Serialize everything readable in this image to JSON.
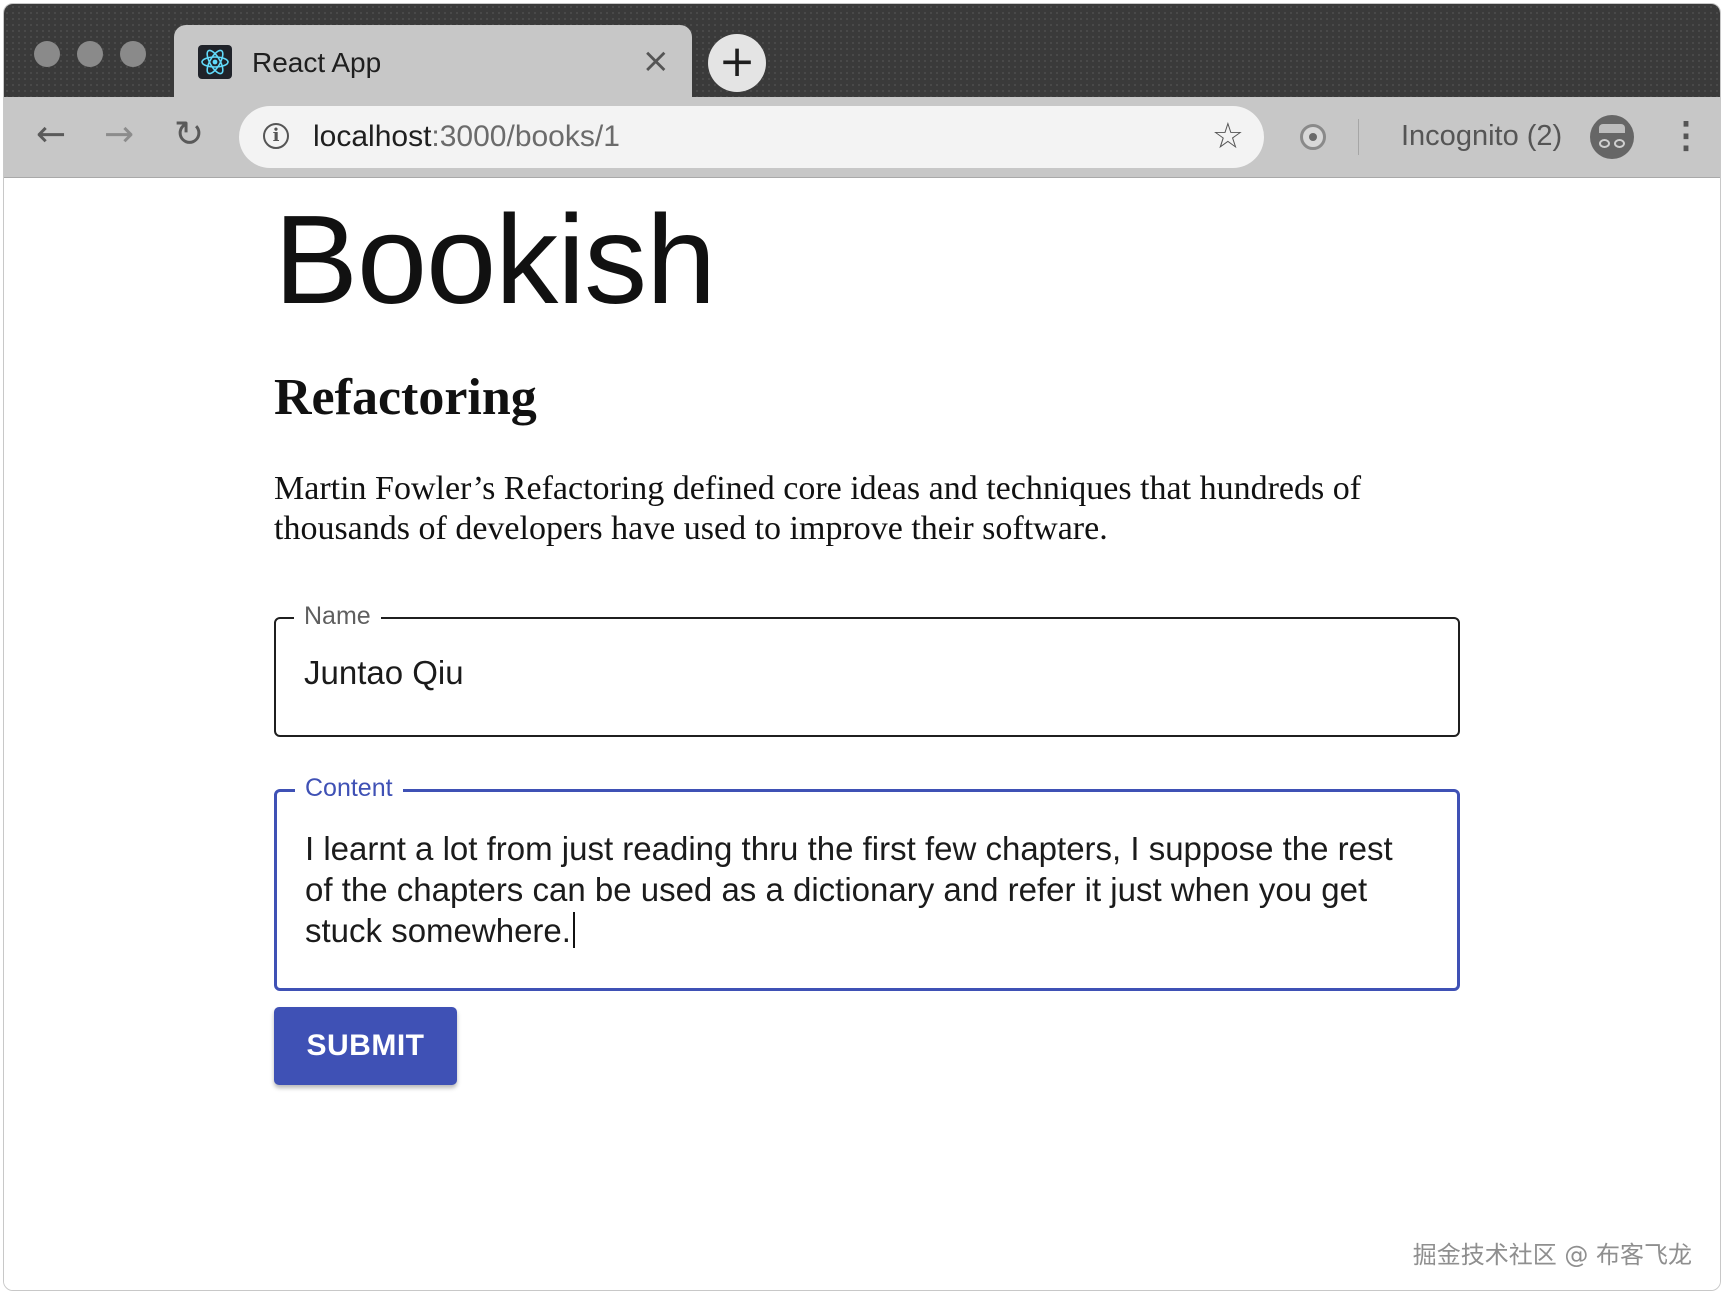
{
  "browser": {
    "tab": {
      "title": "React App",
      "close_icon": "close-icon",
      "favicon": "react-logo-icon"
    },
    "new_tab_label": "+",
    "toolbar": {
      "url_host": "localhost",
      "url_path": ":3000/books/1",
      "incognito_label": "Incognito (2)"
    },
    "icons": {
      "back": "←",
      "forward": "→",
      "reload": "↻",
      "info": "i",
      "star": "☆",
      "close": "×",
      "menu": "⋮"
    }
  },
  "page": {
    "app_title": "Bookish",
    "book": {
      "title": "Refactoring",
      "description": "Martin Fowler’s Refactoring defined core ideas and techniques that hundreds of thousands of developers have used to improve their software."
    },
    "form": {
      "name_label": "Name",
      "name_value": "Juntao Qiu",
      "content_label": "Content",
      "content_value": "I learnt a lot from just reading thru the first few chapters, I suppose the rest of the chapters can be used as a dictionary and refer it just when you get stuck somewhere.",
      "submit_label": "SUBMIT"
    },
    "accent_color": "#3f51b5"
  },
  "watermark": "掘金技术社区 @ 布客飞龙"
}
